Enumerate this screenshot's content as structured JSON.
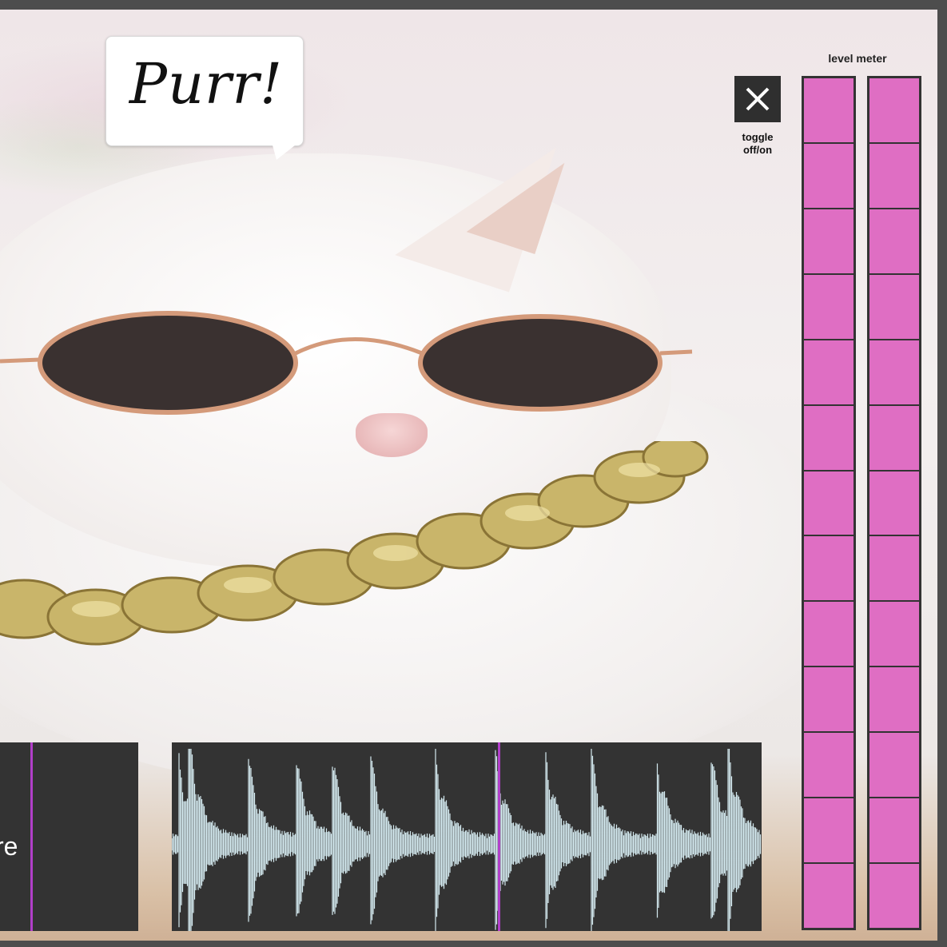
{
  "speech_bubble": {
    "text": "Purr!"
  },
  "toggle": {
    "label": "toggle off/on",
    "icon": "close-icon",
    "state": "off"
  },
  "level_meter": {
    "title": "level meter",
    "color": "#df6ec3",
    "channels": [
      {
        "segments_lit": 13,
        "segments_total": 13
      },
      {
        "segments_lit": 13,
        "segments_total": 13
      }
    ]
  },
  "sample_panel": {
    "label": "re"
  },
  "waveform_panel": {
    "waveform_color": "#d4eaf0",
    "playhead_color": "#b13fc9"
  }
}
